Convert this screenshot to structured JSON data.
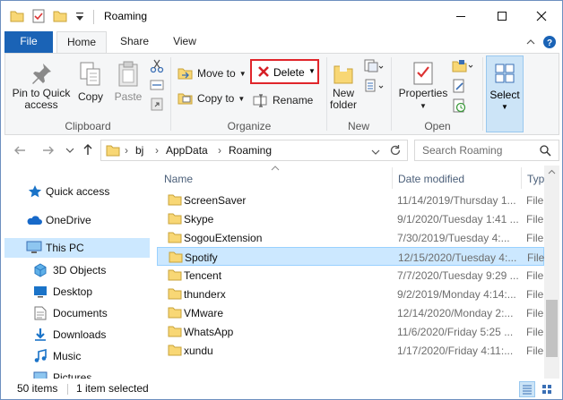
{
  "window": {
    "title": "Roaming",
    "controls": [
      "minimize",
      "maximize",
      "close"
    ]
  },
  "quick_access_toolbar": [
    "folder-icon",
    "properties-check-icon",
    "new-folder-icon",
    "customize-dropdown-icon"
  ],
  "ribbon_tabs": [
    {
      "label": "File",
      "active": false
    },
    {
      "label": "Home",
      "active": true
    },
    {
      "label": "Share",
      "active": false
    },
    {
      "label": "View",
      "active": false
    }
  ],
  "ribbon": {
    "clipboard": {
      "label": "Clipboard",
      "pin_label_1": "Pin to Quick",
      "pin_label_2": "access",
      "copy": "Copy",
      "paste": "Paste"
    },
    "organize": {
      "label": "Organize",
      "move_to": "Move to",
      "copy_to": "Copy to",
      "delete": "Delete",
      "rename": "Rename"
    },
    "new": {
      "label": "New",
      "new_folder_1": "New",
      "new_folder_2": "folder"
    },
    "open": {
      "label": "Open",
      "properties": "Properties"
    },
    "select": {
      "label": "Select"
    }
  },
  "address": {
    "crumbs": [
      "bj",
      "AppData",
      "Roaming"
    ],
    "search_placeholder": "Search Roaming"
  },
  "nav_pane": [
    {
      "label": "Quick access",
      "icon": "star-icon",
      "selected": false
    },
    {
      "label": "OneDrive",
      "icon": "cloud-icon",
      "selected": false
    },
    {
      "label": "This PC",
      "icon": "computer-icon",
      "selected": true
    },
    {
      "label": "3D Objects",
      "icon": "cube-icon",
      "selected": false
    },
    {
      "label": "Desktop",
      "icon": "desktop-icon",
      "selected": false
    },
    {
      "label": "Documents",
      "icon": "document-icon",
      "selected": false
    },
    {
      "label": "Downloads",
      "icon": "download-icon",
      "selected": false
    },
    {
      "label": "Music",
      "icon": "music-icon",
      "selected": false
    },
    {
      "label": "Pictures",
      "icon": "picture-icon",
      "selected": false
    }
  ],
  "columns": {
    "name": "Name",
    "date": "Date modified",
    "type": "Typ"
  },
  "files": [
    {
      "name": "ScreenSaver",
      "date": "11/14/2019/Thursday 1...",
      "type": "File",
      "selected": false
    },
    {
      "name": "Skype",
      "date": "9/1/2020/Tuesday 1:41 ...",
      "type": "File",
      "selected": false
    },
    {
      "name": "SogouExtension",
      "date": "7/30/2019/Tuesday 4:...",
      "type": "File",
      "selected": false
    },
    {
      "name": "Spotify",
      "date": "12/15/2020/Tuesday 4:...",
      "type": "File",
      "selected": true
    },
    {
      "name": "Tencent",
      "date": "7/7/2020/Tuesday 9:29 ...",
      "type": "File",
      "selected": false
    },
    {
      "name": "thunderx",
      "date": "9/2/2019/Monday 4:14:...",
      "type": "File",
      "selected": false
    },
    {
      "name": "VMware",
      "date": "12/14/2020/Monday 2:...",
      "type": "File",
      "selected": false
    },
    {
      "name": "WhatsApp",
      "date": "11/6/2020/Friday 5:25 ...",
      "type": "File",
      "selected": false
    },
    {
      "name": "xundu",
      "date": "1/17/2020/Friday 4:11:...",
      "type": "File",
      "selected": false
    }
  ],
  "status": {
    "count": "50 items",
    "selection": "1 item selected"
  },
  "colors": {
    "file_tab": "#1a63b6",
    "selection": "#cce8ff",
    "folder": "#f8d775",
    "delete_highlight": "#e0252b"
  }
}
